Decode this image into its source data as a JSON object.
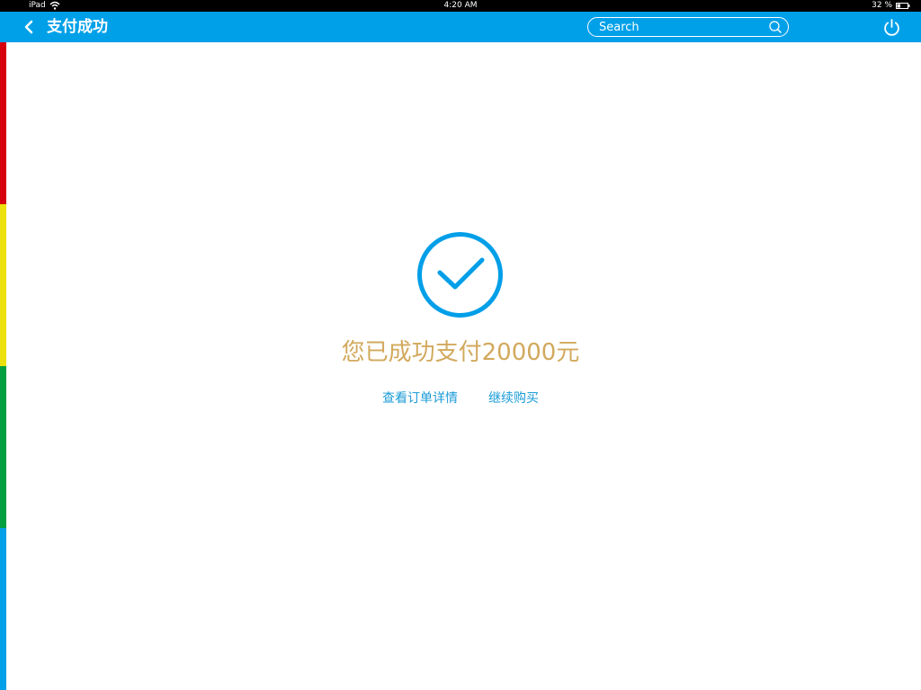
{
  "status_bar": {
    "device": "iPad",
    "time": "4:20 AM",
    "battery_text": "32 %",
    "battery_level": 0.32
  },
  "header": {
    "title": "支付成功",
    "search_placeholder": "Search",
    "icons": {
      "back": "chevron-left-icon",
      "search": "search-icon",
      "power": "power-icon"
    }
  },
  "main": {
    "status_icon": "check-circle-icon",
    "message": "您已成功支付20000元",
    "links": {
      "view_order": "查看订单详情",
      "continue_shopping": "继续购买"
    }
  },
  "colors": {
    "nav_background": "#00a0e9",
    "status_bar_background": "#000000",
    "check_icon": "#009fe8",
    "message_text": "#d2a95d",
    "link_text": "#1a9bd7",
    "stripe": [
      "#d7000f",
      "#ede00f",
      "#009f3f",
      "#00a0e9"
    ]
  }
}
